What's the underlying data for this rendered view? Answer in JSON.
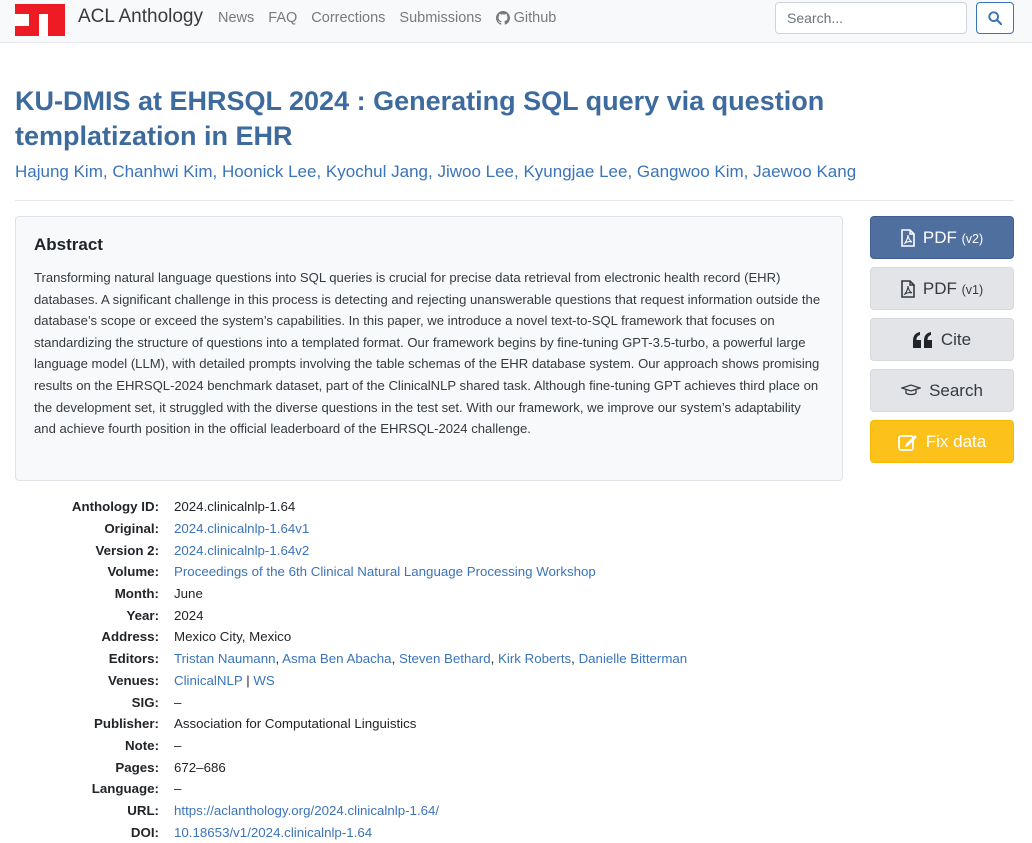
{
  "navbar": {
    "brand": "ACL Anthology",
    "links": [
      "News",
      "FAQ",
      "Corrections",
      "Submissions",
      "Github"
    ],
    "search_placeholder": "Search..."
  },
  "paper": {
    "title": "KU-DMIS at EHRSQL 2024 : Generating SQL query via question templatization in EHR",
    "authors": [
      "Hajung Kim",
      "Chanhwi Kim",
      "Hoonick Lee",
      "Kyochul Jang",
      "Jiwoo Lee",
      "Kyungjae Lee",
      "Gangwoo Kim",
      "Jaewoo Kang"
    ]
  },
  "abstract": {
    "heading": "Abstract",
    "text": "Transforming natural language questions into SQL queries is crucial for precise data retrieval from electronic health record (EHR) databases. A significant challenge in this process is detecting and rejecting unanswerable questions that request information outside the database’s scope or exceed the system’s capabilities. In this paper, we introduce a novel text-to-SQL framework that focuses on standardizing the structure of questions into a templated format. Our framework begins by fine-tuning GPT-3.5-turbo, a powerful large language model (LLM), with detailed prompts involving the table schemas of the EHR database system. Our approach shows promising results on the EHRSQL-2024 benchmark dataset, part of the ClinicalNLP shared task. Although fine-tuning GPT achieves third place on the development set, it struggled with the diverse questions in the test set. With our framework, we improve our system’s adaptability and achieve fourth position in the official leaderboard of the EHRSQL-2024 challenge."
  },
  "buttons": {
    "pdf_v2": "PDF",
    "pdf_v2_tag": "(v2)",
    "pdf_v1": "PDF",
    "pdf_v1_tag": "(v1)",
    "cite": "Cite",
    "search": "Search",
    "fix": "Fix data"
  },
  "meta": {
    "anthology_id_label": "Anthology ID:",
    "anthology_id": "2024.clinicalnlp-1.64",
    "original_label": "Original:",
    "original": "2024.clinicalnlp-1.64v1",
    "version2_label": "Version 2:",
    "version2": "2024.clinicalnlp-1.64v2",
    "volume_label": "Volume:",
    "volume": "Proceedings of the 6th Clinical Natural Language Processing Workshop",
    "month_label": "Month:",
    "month": "June",
    "year_label": "Year:",
    "year": "2024",
    "address_label": "Address:",
    "address": "Mexico City, Mexico",
    "editors_label": "Editors:",
    "editors": [
      "Tristan Naumann",
      "Asma Ben Abacha",
      "Steven Bethard",
      "Kirk Roberts",
      "Danielle Bitterman"
    ],
    "venues_label": "Venues:",
    "venues": [
      "ClinicalNLP",
      "WS"
    ],
    "venue_sep": "|",
    "sig_label": "SIG:",
    "sig": "–",
    "publisher_label": "Publisher:",
    "publisher": "Association for Computational Linguistics",
    "note_label": "Note:",
    "note": "–",
    "pages_label": "Pages:",
    "pages": "672–686",
    "language_label": "Language:",
    "language": "–",
    "url_label": "URL:",
    "url": "https://aclanthology.org/2024.clinicalnlp-1.64/",
    "doi_label": "DOI:",
    "doi": "10.18653/v1/2024.clinicalnlp-1.64"
  },
  "colors": {
    "accent": "#3b74b9",
    "title": "#3e6b9e",
    "logo": "#ed1c24",
    "warning": "#fdc11b",
    "primary": "#4f6f9e"
  }
}
